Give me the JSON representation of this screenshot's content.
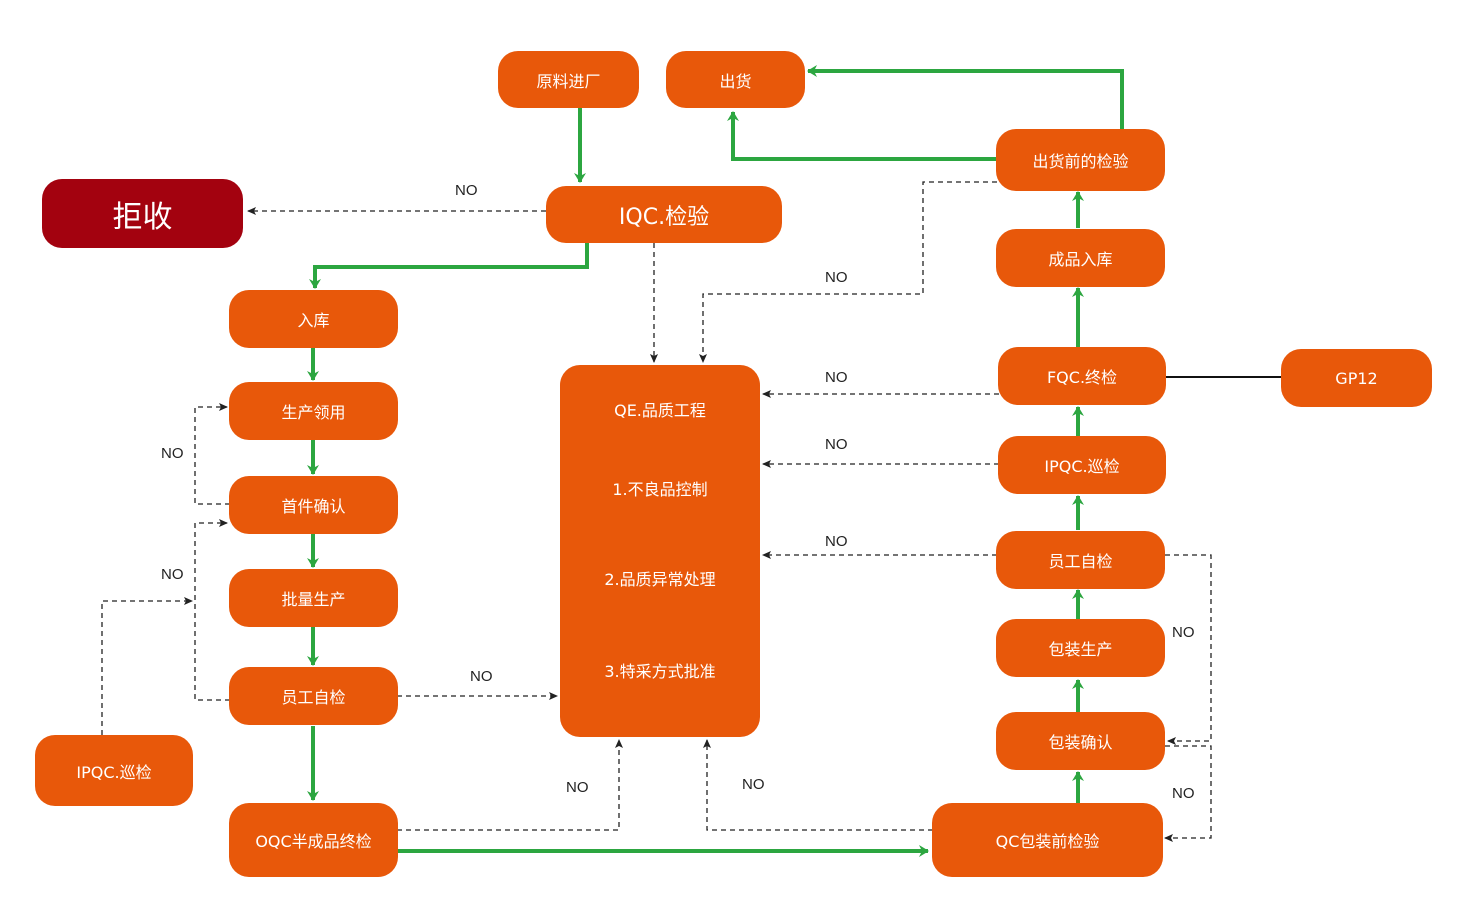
{
  "colors": {
    "node": "#e8580a",
    "reject": "#a3020f",
    "flow": "#2ca640",
    "dashed": "#222222",
    "text": "#ffffff"
  },
  "nodes": {
    "raw_material": "原料进厂",
    "shipping": "出货",
    "reject": "拒收",
    "iqc": "IQC.检验",
    "pre_ship_inspection": "出货前的检验",
    "warehousing": "入库",
    "finished_warehousing": "成品入库",
    "production_requisition": "生产领用",
    "first_article": "首件确认",
    "mass_production": "批量生产",
    "self_check_left": "员工自检",
    "ipqc_left": "IPQC.巡检",
    "oqc": "OQC半成品终检",
    "fqc": "FQC.终检",
    "gp12": "GP12",
    "ipqc_right": "IPQC.巡检",
    "self_check_right": "员工自检",
    "packing_production": "包装生产",
    "packing_confirm": "包装确认",
    "qc_pre_packing": "QC包装前检验"
  },
  "qe": {
    "title": "QE.品质工程",
    "items": [
      "1.不良品控制",
      "2.品质异常处理",
      "3.特采方式批准"
    ]
  },
  "edge_labels": {
    "no": "NO"
  }
}
